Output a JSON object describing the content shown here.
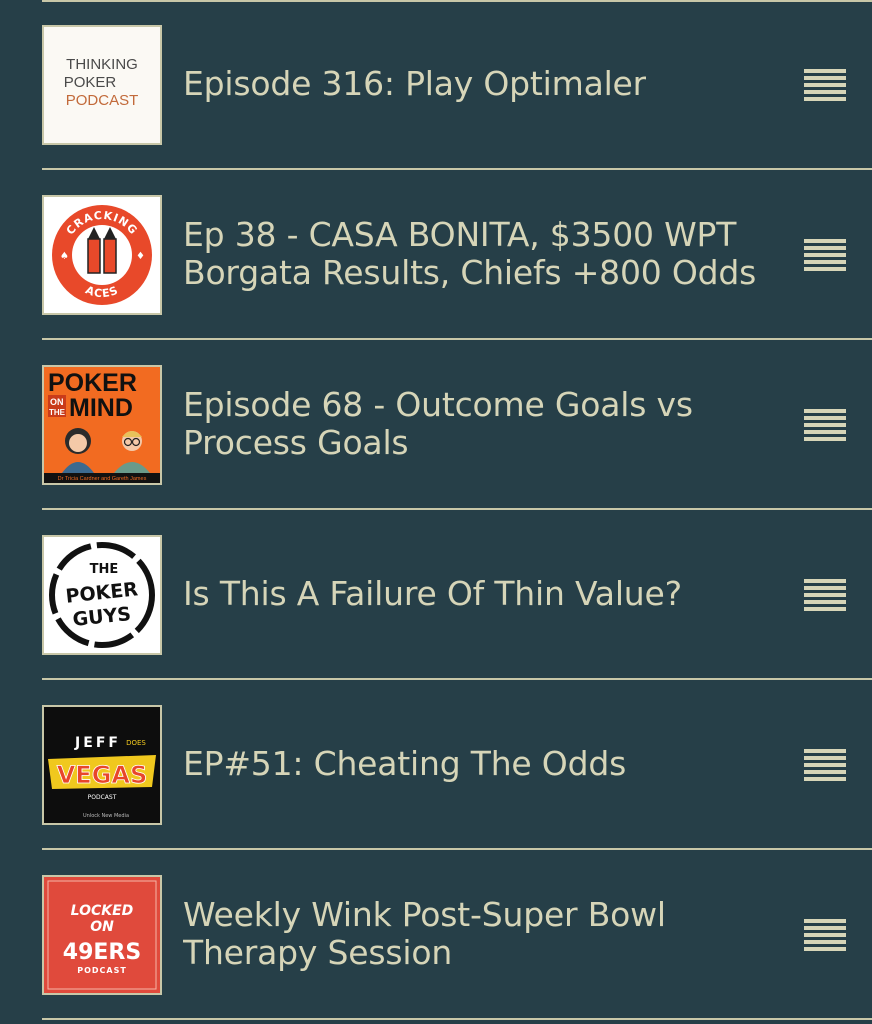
{
  "episodes": [
    {
      "title": "Episode 316: Play Optimaler",
      "artwork": {
        "icon": "thinking-poker-podcast-artwork",
        "lines": [
          "THINKING",
          "POKER",
          "PODCAST"
        ],
        "colors": {
          "background": "#fbf9f4",
          "text": "#4a4a4a",
          "accent": "#c26a3a"
        }
      }
    },
    {
      "title": "Ep 38 - CASA BONITA, $3500 WPT Borgata Results, Chiefs +800 Odds",
      "artwork": {
        "icon": "cracking-aces-artwork",
        "top": "CRACKING",
        "bottom": "ACES",
        "colors": {
          "background": "#ffffff",
          "ring": "#e8492a",
          "text": "#ffffff"
        }
      }
    },
    {
      "title": "Episode 68 - Outcome Goals vs Process Goals",
      "artwork": {
        "icon": "poker-on-the-mind-artwork",
        "word1": "POKER",
        "word2": "ON",
        "word3": "THE",
        "word4": "MIND",
        "caption": "Dr Tricia Cardner and Gareth James",
        "colors": {
          "background": "#f26b21",
          "text": "#111111"
        }
      }
    },
    {
      "title": "Is This A Failure Of Thin Value?",
      "artwork": {
        "icon": "the-poker-guys-artwork",
        "word1": "THE",
        "word2": "POKER",
        "word3": "GUYS",
        "colors": {
          "background": "#ffffff",
          "text": "#111111"
        }
      }
    },
    {
      "title": "EP#51: Cheating The Odds",
      "artwork": {
        "icon": "jeff-does-vegas-artwork",
        "word1": "JEFF",
        "word2": "DOES",
        "word3": "VEGAS",
        "word4": "PODCAST",
        "network": "Unlock New Media",
        "colors": {
          "background": "#0d0d0d",
          "accent": "#f0c81e",
          "text": "#e8462a"
        }
      }
    },
    {
      "title": "Weekly Wink Post-Super Bowl Therapy Session",
      "artwork": {
        "icon": "locked-on-49ers-artwork",
        "word1": "LOCKED",
        "word2": "ON",
        "word3": "49ERS",
        "word4": "PODCAST",
        "colors": {
          "background": "#e04a3c",
          "text": "#ffffff"
        }
      }
    }
  ],
  "menu_icon": "reorder-handle-icon",
  "colors": {
    "background": "#263f48",
    "text": "#d6d5b8",
    "divider": "#c8c7a8"
  }
}
